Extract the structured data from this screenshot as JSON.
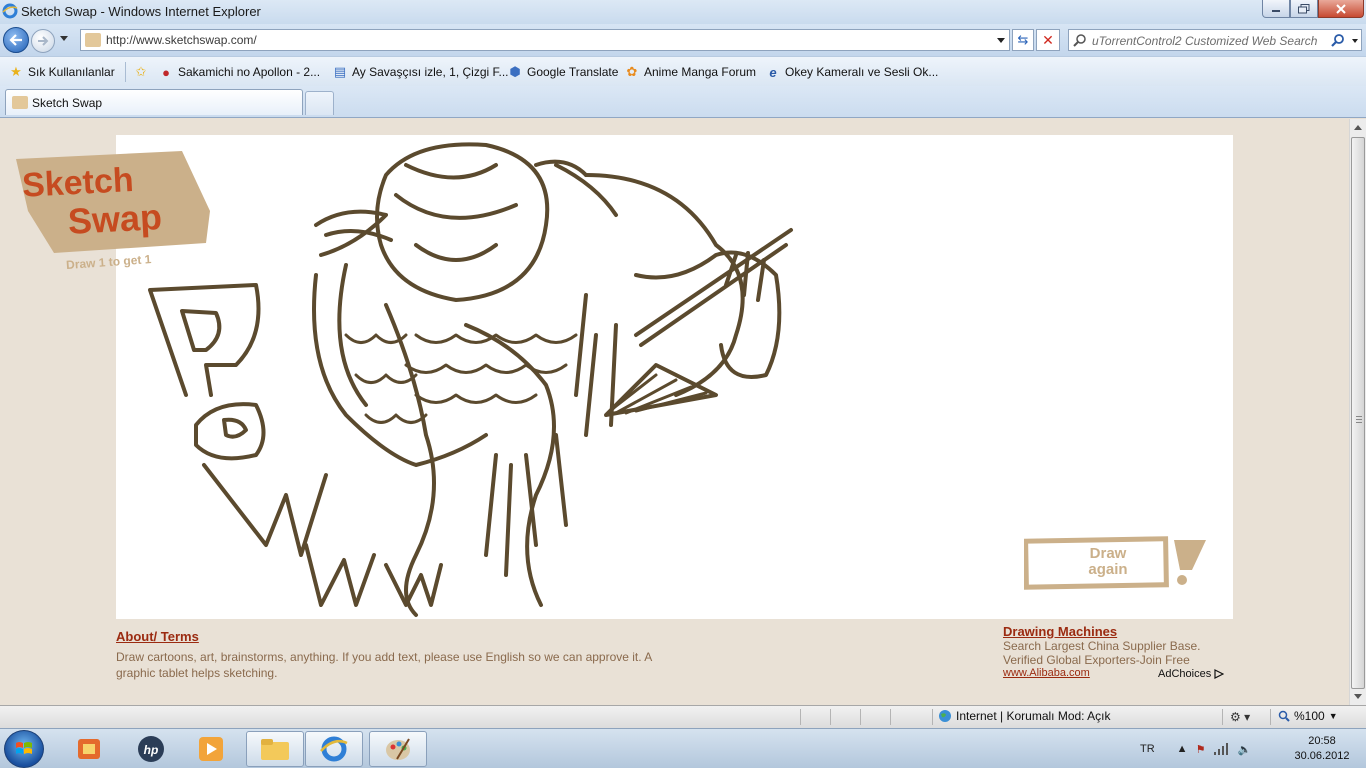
{
  "window": {
    "title": "Sketch Swap - Windows Internet Explorer"
  },
  "navbar": {
    "url": "http://www.sketchswap.com/",
    "search_placeholder": "uTorrentControl2 Customized Web Search"
  },
  "favorites": {
    "items": [
      {
        "label": "Sık Kullanılanlar",
        "icon": "star-icon"
      },
      {
        "label": "Sakamichi no Apollon - 2...",
        "icon": "site-icon"
      },
      {
        "label": "Ay Savaşçısı izle, 1, Çizgi F...",
        "icon": "page-icon"
      },
      {
        "label": "Google Translate",
        "icon": "translate-icon"
      },
      {
        "label": "Anime Manga Forum",
        "icon": "forum-icon"
      },
      {
        "label": "Okey  Kameralı ve Sesli Ok...",
        "icon": "ie-icon"
      }
    ]
  },
  "tabs": [
    {
      "label": "Sketch Swap"
    }
  ],
  "page": {
    "logo_line1": "Sketch",
    "logo_line2": "Swap",
    "logo_tagline": "Draw 1 to get 1",
    "draw_again_line1": "Draw",
    "draw_again_line2": "again",
    "about_link": "About/ Terms",
    "about_text": "Draw cartoons, art, brainstorms, anything. If you add text, please use English so we can approve it. A graphic tablet helps sketching.",
    "ad": {
      "title": "Drawing Machines",
      "line1": "Search Largest China Supplier Base.",
      "line2": "Verified Global Exporters-Join Free",
      "url": "www.Alibaba.com",
      "adchoices": "AdChoices"
    }
  },
  "statusbar": {
    "zone": "Internet | Korumalı Mod: Açık",
    "zoom": "%100"
  },
  "taskbar": {
    "language": "TR",
    "time": "20:58",
    "date": "30.06.2012"
  },
  "colors": {
    "sketch_stroke": "#5b4a2e",
    "page_bg": "#e9e1d6",
    "link": "#9b2a10",
    "logo_red": "#c64b20",
    "logo_tan": "#cbb08a"
  }
}
